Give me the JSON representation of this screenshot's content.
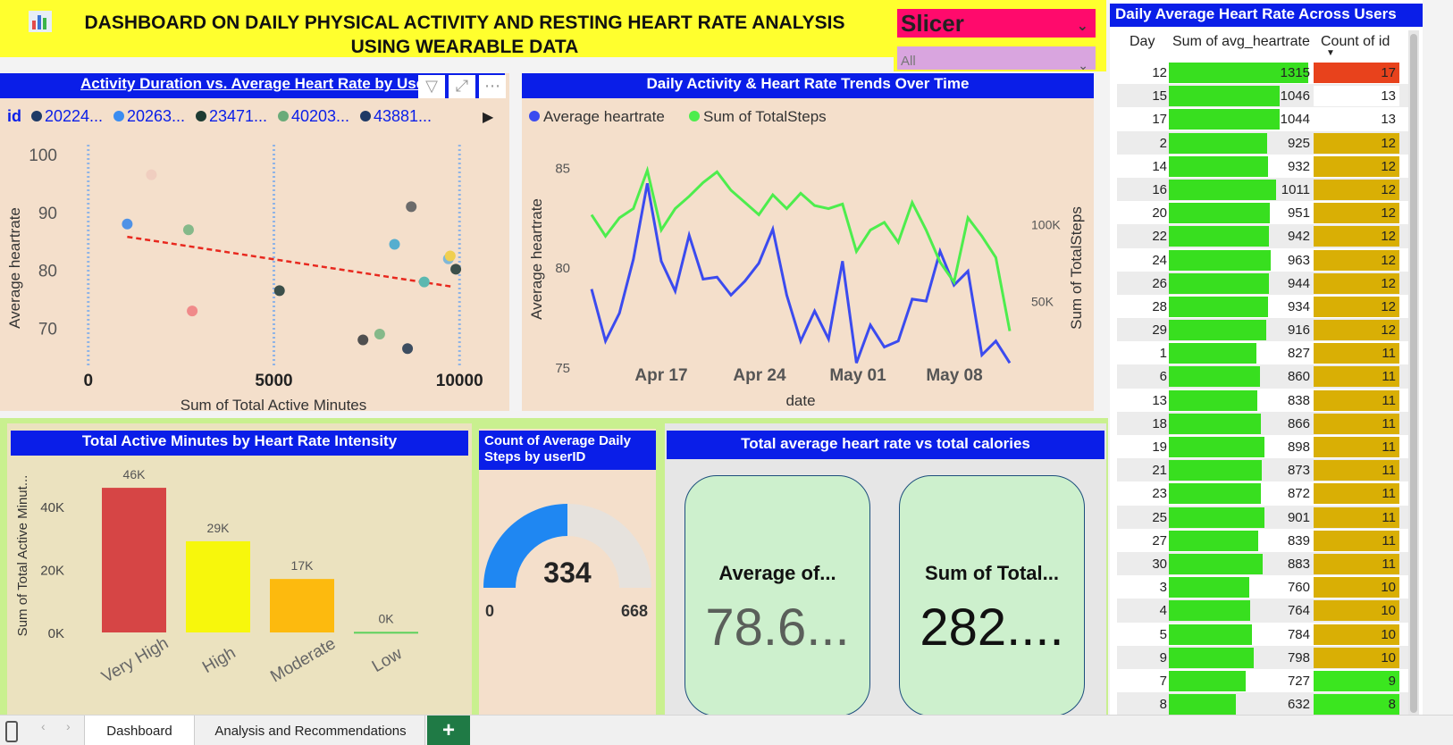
{
  "header": {
    "title": "DASHBOARD ON DAILY PHYSICAL ACTIVITY AND RESTING HEART RATE ANALYSIS USING WEARABLE DATA",
    "logo_icon": "bar-chart-icon"
  },
  "slicer": {
    "title": "Slicer",
    "selected": "All"
  },
  "scatter": {
    "title": "Activity Duration vs. Average Heart Rate by Use",
    "legend_label": "id",
    "legend_items": [
      "20224...",
      "20263...",
      "23471...",
      "40203...",
      "43881..."
    ],
    "legend_colors": [
      "#1e3a66",
      "#3b8cf0",
      "#1d3b33",
      "#6aab79",
      "#1e3a66"
    ],
    "chart_data": {
      "type": "scatter",
      "xlabel": "Sum of Total Active Minutes",
      "ylabel": "Average heartrate",
      "xlim": [
        -500,
        10500
      ],
      "ylim": [
        65,
        102
      ],
      "x_ticks": [
        "0",
        "5000",
        "10000"
      ],
      "y_ticks": [
        "100",
        "90",
        "80",
        "70"
      ],
      "points": [
        {
          "x": 1050,
          "y": 88,
          "color": "#4f92e6"
        },
        {
          "x": 1700,
          "y": 96.5,
          "color": "#f0cec0"
        },
        {
          "x": 2700,
          "y": 87,
          "color": "#85b98a"
        },
        {
          "x": 2800,
          "y": 73,
          "color": "#f08a8a"
        },
        {
          "x": 5150,
          "y": 76.5,
          "color": "#3b4f4a"
        },
        {
          "x": 7400,
          "y": 68,
          "color": "#4f4f4f"
        },
        {
          "x": 7850,
          "y": 69,
          "color": "#85b98a"
        },
        {
          "x": 8250,
          "y": 84.5,
          "color": "#55aecf"
        },
        {
          "x": 8600,
          "y": 66.5,
          "color": "#3c4d60"
        },
        {
          "x": 8700,
          "y": 91,
          "color": "#6b6b6b"
        },
        {
          "x": 9050,
          "y": 78,
          "color": "#5bb8b0"
        },
        {
          "x": 9700,
          "y": 82,
          "color": "#7fb7d8"
        },
        {
          "x": 9750,
          "y": 82.5,
          "color": "#f0cf50"
        },
        {
          "x": 9900,
          "y": 80.2,
          "color": "#3b4f4a"
        }
      ],
      "trendline": {
        "x": [
          1050,
          9800
        ],
        "y": [
          85.8,
          77.2
        ],
        "color": "#e8281e"
      },
      "vertical_guides": [
        0,
        5000,
        10000
      ]
    }
  },
  "trends": {
    "title": "Daily Activity & Heart Rate Trends Over Time",
    "legend": [
      {
        "name": "Average heartrate",
        "color": "#3b4bef"
      },
      {
        "name": "Sum of TotalSteps",
        "color": "#4ded4d"
      }
    ],
    "chart_data": {
      "type": "line",
      "xlabel": "date",
      "ylabel": "Average heartrate",
      "ylabel2": "Sum of TotalSteps",
      "x_ticks": [
        "Apr 17",
        "Apr 24",
        "May 01",
        "May 08"
      ],
      "y_ticks": [
        "85",
        "80",
        "75"
      ],
      "y2_ticks": [
        "100K",
        "50K"
      ],
      "ylim": [
        74.5,
        86
      ],
      "y2lim": [
        0,
        150000
      ],
      "series": [
        {
          "name": "Average heartrate",
          "values": [
            78.9,
            76.3,
            77.7,
            80.4,
            84.2,
            80.3,
            78.8,
            81.6,
            79.4,
            79.5,
            78.6,
            79.3,
            80.2,
            81.9,
            78.6,
            76.3,
            77.8,
            76.4,
            80.3,
            75.2,
            77.1,
            76.0,
            76.3,
            78.4,
            78.3,
            80.8,
            79.1,
            79.8,
            75.6,
            76.3,
            75.2
          ]
        },
        {
          "name": "Sum of TotalSteps",
          "values": [
            106000,
            92000,
            104000,
            110000,
            135000,
            96000,
            110000,
            118000,
            127000,
            134000,
            122000,
            114000,
            106000,
            119000,
            110000,
            120000,
            112000,
            110000,
            113000,
            82000,
            96000,
            101000,
            88000,
            114000,
            96000,
            75000,
            62000,
            104000,
            92000,
            78000,
            30000
          ]
        }
      ]
    }
  },
  "table": {
    "title": "Daily Average Heart Rate Across Users",
    "headers": [
      "Day",
      "Sum of avg_heartrate",
      "Count of id"
    ],
    "sort_icon": "sort-desc-icon",
    "max_hr": 1315,
    "rows": [
      {
        "day": "12",
        "hr": "1315",
        "cnt": "17",
        "cnt_color": "#e8421c"
      },
      {
        "day": "15",
        "hr": "1046",
        "cnt": "13",
        "cnt_color": "#ffffff"
      },
      {
        "day": "17",
        "hr": "1044",
        "cnt": "13",
        "cnt_color": "#ffffff"
      },
      {
        "day": "2",
        "hr": "925",
        "cnt": "12",
        "cnt_color": "#d9af05"
      },
      {
        "day": "14",
        "hr": "932",
        "cnt": "12",
        "cnt_color": "#d9af05"
      },
      {
        "day": "16",
        "hr": "1011",
        "cnt": "12",
        "cnt_color": "#d9af05"
      },
      {
        "day": "20",
        "hr": "951",
        "cnt": "12",
        "cnt_color": "#d9af05"
      },
      {
        "day": "22",
        "hr": "942",
        "cnt": "12",
        "cnt_color": "#d9af05"
      },
      {
        "day": "24",
        "hr": "963",
        "cnt": "12",
        "cnt_color": "#d9af05"
      },
      {
        "day": "26",
        "hr": "944",
        "cnt": "12",
        "cnt_color": "#d9af05"
      },
      {
        "day": "28",
        "hr": "934",
        "cnt": "12",
        "cnt_color": "#d9af05"
      },
      {
        "day": "29",
        "hr": "916",
        "cnt": "12",
        "cnt_color": "#d9af05"
      },
      {
        "day": "1",
        "hr": "827",
        "cnt": "11",
        "cnt_color": "#d9af05"
      },
      {
        "day": "6",
        "hr": "860",
        "cnt": "11",
        "cnt_color": "#d9af05"
      },
      {
        "day": "13",
        "hr": "838",
        "cnt": "11",
        "cnt_color": "#d9af05"
      },
      {
        "day": "18",
        "hr": "866",
        "cnt": "11",
        "cnt_color": "#d9af05"
      },
      {
        "day": "19",
        "hr": "898",
        "cnt": "11",
        "cnt_color": "#d9af05"
      },
      {
        "day": "21",
        "hr": "873",
        "cnt": "11",
        "cnt_color": "#d9af05"
      },
      {
        "day": "23",
        "hr": "872",
        "cnt": "11",
        "cnt_color": "#d9af05"
      },
      {
        "day": "25",
        "hr": "901",
        "cnt": "11",
        "cnt_color": "#d9af05"
      },
      {
        "day": "27",
        "hr": "839",
        "cnt": "11",
        "cnt_color": "#d9af05"
      },
      {
        "day": "30",
        "hr": "883",
        "cnt": "11",
        "cnt_color": "#d9af05"
      },
      {
        "day": "3",
        "hr": "760",
        "cnt": "10",
        "cnt_color": "#d9af05"
      },
      {
        "day": "4",
        "hr": "764",
        "cnt": "10",
        "cnt_color": "#d9af05"
      },
      {
        "day": "5",
        "hr": "784",
        "cnt": "10",
        "cnt_color": "#d9af05"
      },
      {
        "day": "9",
        "hr": "798",
        "cnt": "10",
        "cnt_color": "#d9af05"
      },
      {
        "day": "7",
        "hr": "727",
        "cnt": "9",
        "cnt_color": "#3be61f"
      },
      {
        "day": "8",
        "hr": "632",
        "cnt": "8",
        "cnt_color": "#3be61f"
      }
    ]
  },
  "bars": {
    "title": "Total Active Minutes by Heart Rate Intensity",
    "chart_data": {
      "type": "bar",
      "categories": [
        "Very High",
        "High",
        "Moderate",
        "Low"
      ],
      "values": [
        46000,
        29000,
        17000,
        200
      ],
      "data_labels": [
        "46K",
        "29K",
        "17K",
        "0K"
      ],
      "colors": [
        "#d64545",
        "#f7f70c",
        "#fdba0e",
        "#5bd15b"
      ],
      "ylabel": "Sum of Total Active Minut...",
      "y_ticks": [
        "40K",
        "20K",
        "0K"
      ],
      "ylim": [
        0,
        50000
      ]
    }
  },
  "gauge": {
    "title": "Count of Average Daily Steps by userID",
    "value": 334,
    "value_label": "334",
    "min_label": "0",
    "max_label": "668",
    "fraction": 0.5,
    "fill_color": "#1f87f2",
    "track_color": "#e6e2dd"
  },
  "kpi": {
    "title": "Total average heart rate vs total calories",
    "cards": [
      {
        "label": "Average of...",
        "value": "78.6...",
        "value_color": "#5a5f5a"
      },
      {
        "label": "Sum of Total...",
        "value": "282....",
        "value_color": "#111111"
      }
    ]
  },
  "tabs": {
    "items": [
      "Dashboard",
      "Analysis and Recommendations"
    ],
    "add_label": "+",
    "active": "Dashboard"
  }
}
